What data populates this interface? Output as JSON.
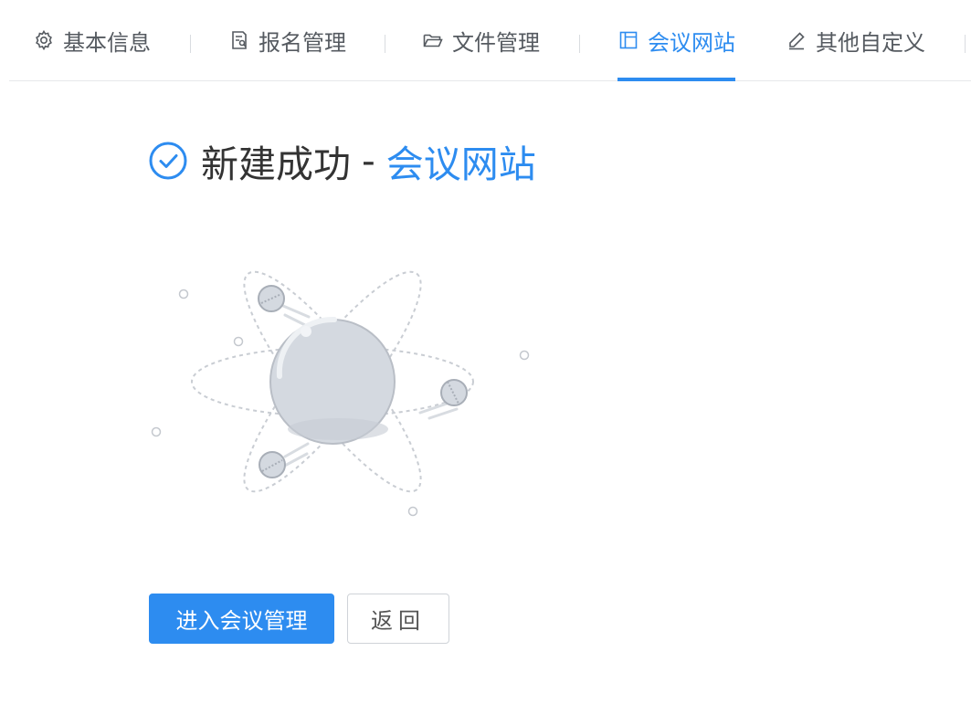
{
  "tabs": [
    {
      "label": "基本信息",
      "icon": "gear-icon",
      "active": false
    },
    {
      "label": "报名管理",
      "icon": "form-icon",
      "active": false
    },
    {
      "label": "文件管理",
      "icon": "folder-open-icon",
      "active": false
    },
    {
      "label": "会议网站",
      "icon": "layout-icon",
      "active": true
    },
    {
      "label": "其他自定义",
      "icon": "edit-icon",
      "active": false
    }
  ],
  "result": {
    "status_icon": "check-circle-icon",
    "title_prefix": "新建成功",
    "title_separator": "-",
    "title_highlight": "会议网站"
  },
  "actions": {
    "primary_label": "进入会议管理",
    "back_label": "返回"
  },
  "colors": {
    "accent": "#2d8cf0",
    "text": "#333333",
    "tab_text": "#555a60",
    "border": "#e6e8eb"
  }
}
